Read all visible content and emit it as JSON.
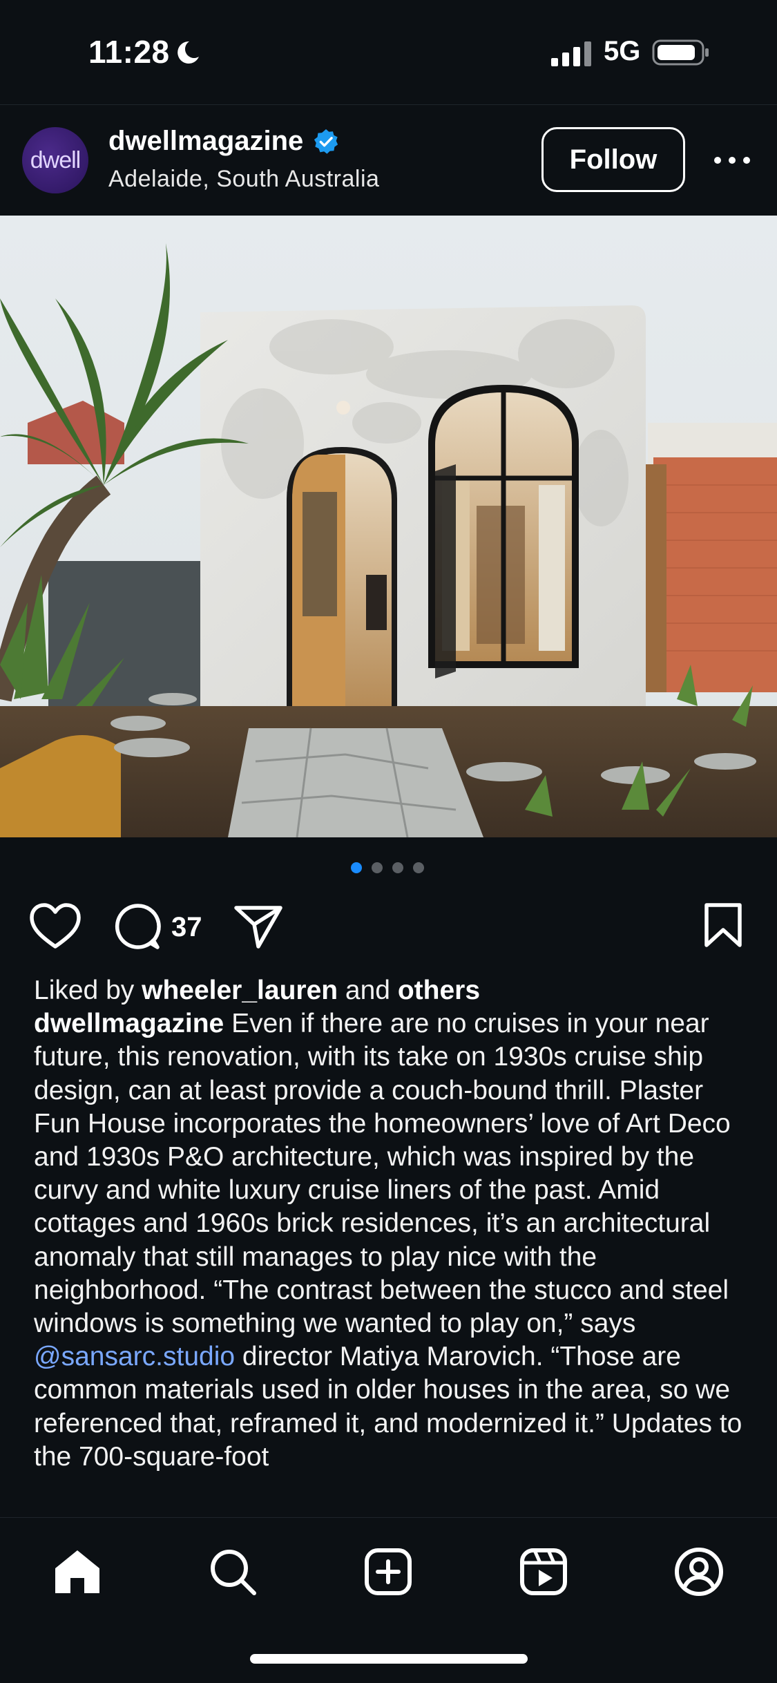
{
  "status_bar": {
    "time": "11:28",
    "network": "5G",
    "icons": [
      "moon-icon",
      "signal-icon",
      "battery-icon"
    ]
  },
  "post": {
    "avatar_text": "dwell",
    "username": "dwellmagazine",
    "verified": true,
    "location": "Adelaide, South Australia",
    "follow_label": "Follow",
    "image_alt": "White stucco house with arched steel windows and a palm tree",
    "carousel": {
      "count": 4,
      "active_index": 0
    },
    "comment_count": "37",
    "liked_by": {
      "prefix": "Liked by ",
      "user": "wheeler_lauren",
      "middle": " and ",
      "others": "others"
    },
    "caption": {
      "author": "dwellmagazine",
      "text_part1": "Even if there are no cruises in your near future, this renovation, with its take on 1930s cruise ship design, can at least provide a couch-bound thrill. Plaster Fun House incorporates the homeowners’ love of Art Deco and 1930s P&O architecture, which was inspired by the curvy and white luxury cruise liners of the past. Amid cottages and 1960s brick residences, it’s an architectural anomaly that still manages to play nice with the neighborhood. “The contrast between the stucco and steel windows is something we wanted to play on,” says ",
      "mention": "@sansarc.studio",
      "text_part2": " director Matiya Marovich. “Those are common materials used in older houses in the area, so we referenced that, reframed it, and modernized it.” Updates to the 700-square-foot"
    }
  },
  "colors": {
    "background": "#0c1014",
    "accent_blue": "#1a8cff",
    "mention": "#7aa8ff",
    "verified": "#1d9bf0"
  },
  "bottom_nav": {
    "items": [
      "home-icon",
      "search-icon",
      "create-icon",
      "reels-icon",
      "profile-icon"
    ]
  }
}
